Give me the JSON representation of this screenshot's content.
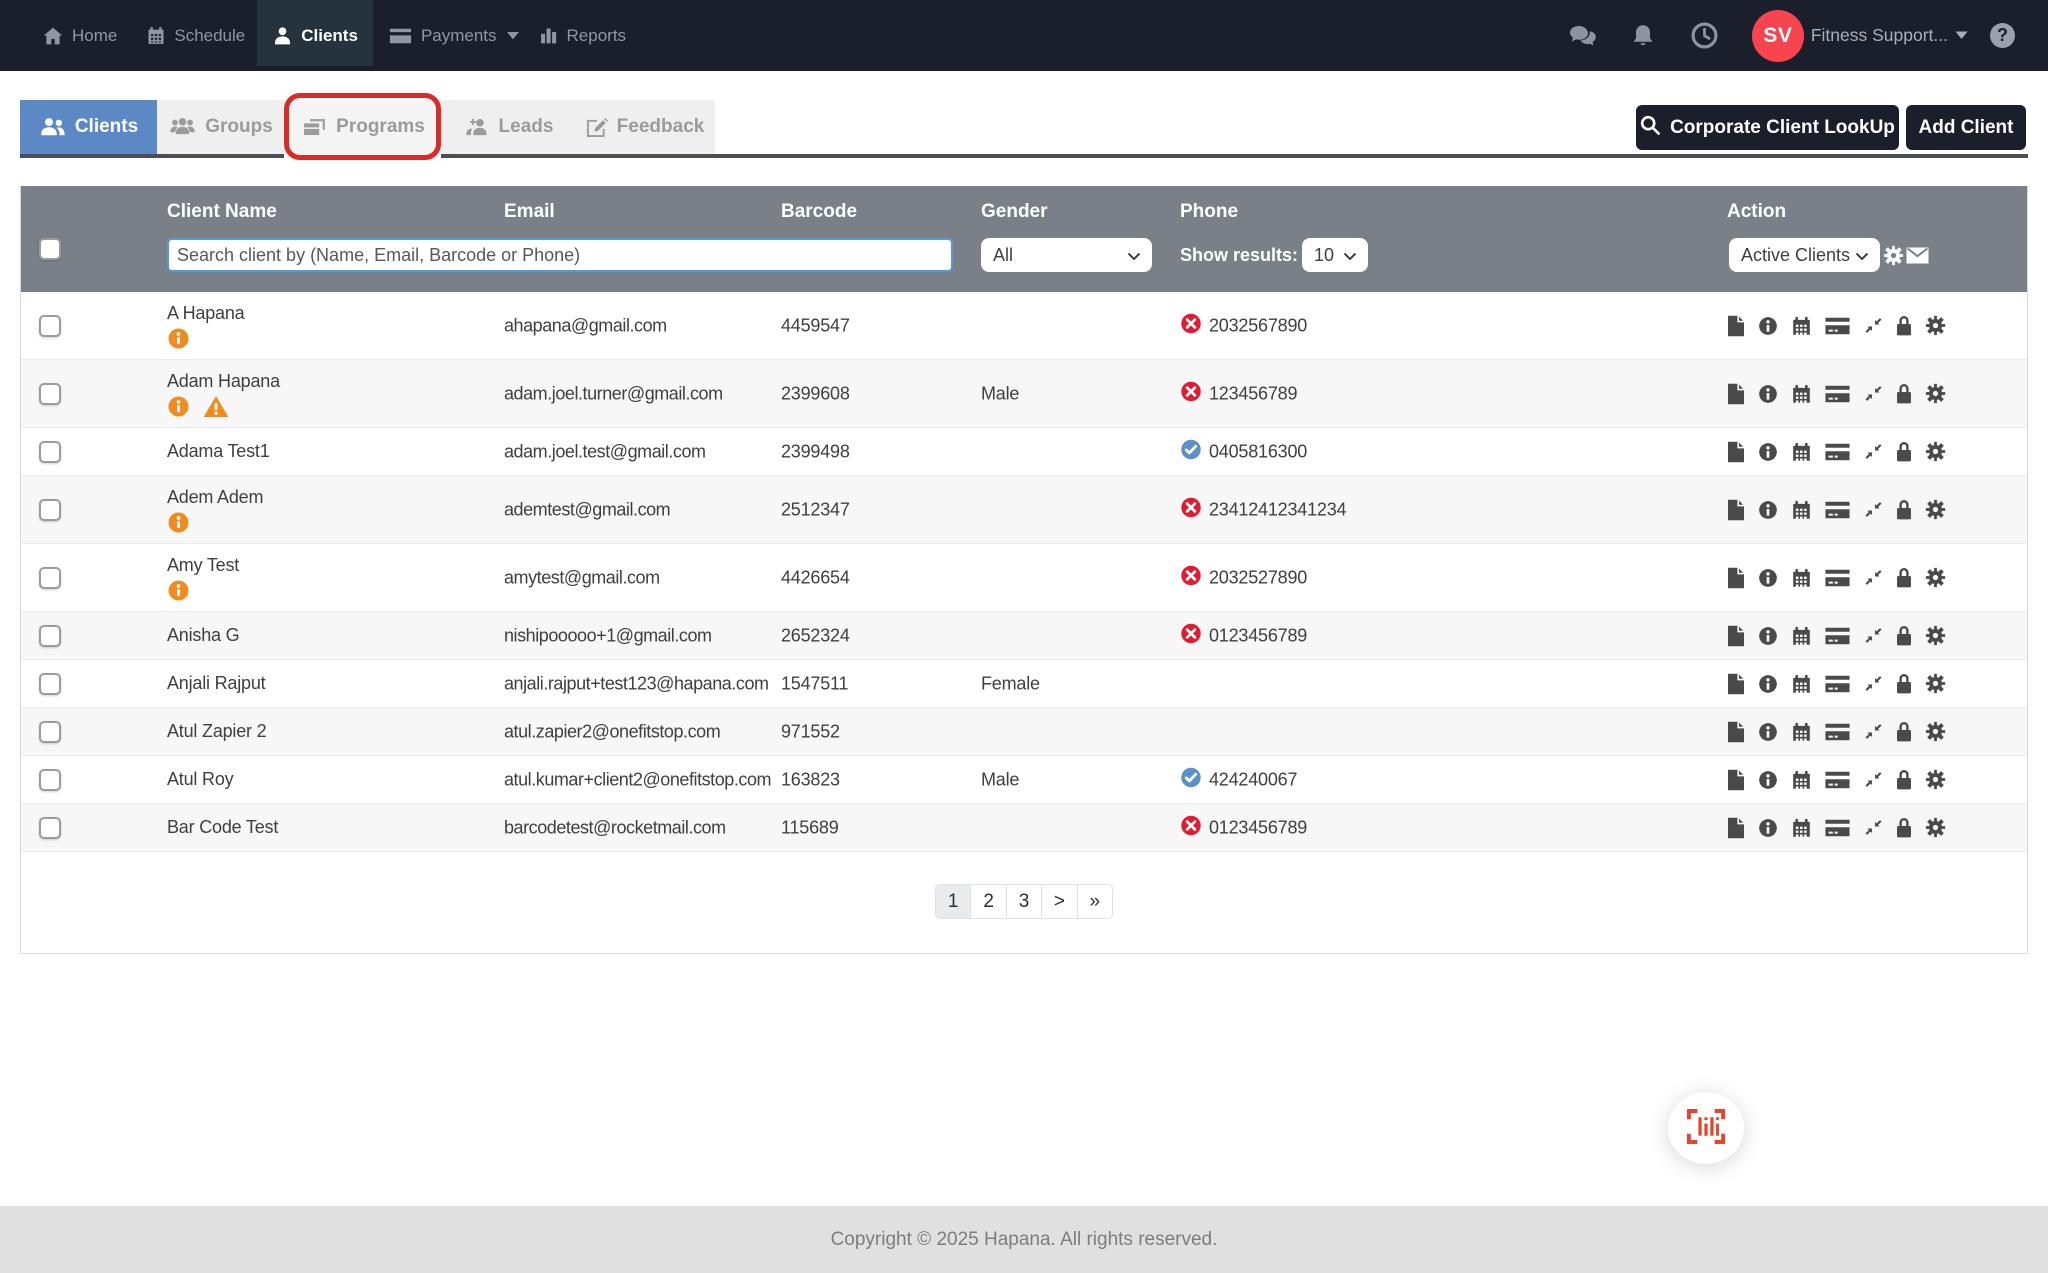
{
  "navbar": {
    "items": [
      {
        "label": "Home",
        "icon": "home-icon",
        "active": false
      },
      {
        "label": "Schedule",
        "icon": "calendar-icon",
        "active": false
      },
      {
        "label": "Clients",
        "icon": "user-icon",
        "active": true
      },
      {
        "label": "Payments",
        "icon": "credit-card-icon",
        "active": false,
        "has_dropdown": true
      },
      {
        "label": "Reports",
        "icon": "bar-chart-icon",
        "active": false
      }
    ],
    "right": {
      "icons": [
        "chat-icon",
        "bell-icon",
        "clock-icon"
      ],
      "avatar_initials": "SV",
      "user_name": "Fitness Support...",
      "help_label": "?"
    }
  },
  "tabs": [
    {
      "label": "Clients",
      "icon": "users-icon",
      "active": true
    },
    {
      "label": "Groups",
      "icon": "group-icon",
      "active": false
    },
    {
      "label": "Programs",
      "icon": "programs-icon",
      "active": false,
      "annotated": true
    },
    {
      "label": "Leads",
      "icon": "leads-icon",
      "active": false
    },
    {
      "label": "Feedback",
      "icon": "feedback-icon",
      "active": false
    }
  ],
  "annotation": {
    "type": "highlight-box",
    "target_tab": "Programs",
    "color": "#d92b27"
  },
  "actions_bar": {
    "corporate_button": "Corporate Client LookUp",
    "add_button": "Add Client"
  },
  "table": {
    "columns": {
      "name": "Client Name",
      "email": "Email",
      "barcode": "Barcode",
      "gender": "Gender",
      "phone": "Phone",
      "action": "Action"
    },
    "filters": {
      "search_placeholder": "Search client by (Name, Email, Barcode or Phone)",
      "gender_selected": "All",
      "show_results_label": "Show results:",
      "show_results_selected": "10",
      "status_selected": "Active Clients",
      "tool_icons": [
        "gear-icon",
        "envelope-icon"
      ]
    },
    "action_icons": [
      "document-icon",
      "info-icon",
      "calendar-icon",
      "payment-card-icon",
      "compress-icon",
      "lock-icon",
      "gear-icon"
    ],
    "rows": [
      {
        "name": "A Hapana",
        "info": true,
        "warning": false,
        "email": "ahapana@gmail.com",
        "barcode": "4459547",
        "gender": "",
        "phone_status": "invalid",
        "phone": "2032567890"
      },
      {
        "name": "Adam Hapana",
        "info": true,
        "warning": true,
        "email": "adam.joel.turner@gmail.com",
        "barcode": "2399608",
        "gender": "Male",
        "phone_status": "invalid",
        "phone": "123456789"
      },
      {
        "name": "Adama Test1",
        "info": false,
        "warning": false,
        "email": "adam.joel.test@gmail.com",
        "barcode": "2399498",
        "gender": "",
        "phone_status": "valid",
        "phone": "0405816300"
      },
      {
        "name": "Adem Adem",
        "info": true,
        "warning": false,
        "email": "ademtest@gmail.com",
        "barcode": "2512347",
        "gender": "",
        "phone_status": "invalid",
        "phone": "23412412341234"
      },
      {
        "name": "Amy Test",
        "info": true,
        "warning": false,
        "email": "amytest@gmail.com",
        "barcode": "4426654",
        "gender": "",
        "phone_status": "invalid",
        "phone": "2032527890"
      },
      {
        "name": "Anisha G",
        "info": false,
        "warning": false,
        "email": "nishipooooo+1@gmail.com",
        "barcode": "2652324",
        "gender": "",
        "phone_status": "invalid",
        "phone": "0123456789"
      },
      {
        "name": "Anjali Rajput",
        "info": false,
        "warning": false,
        "email": "anjali.rajput+test123@hapana.com",
        "barcode": "1547511",
        "gender": "Female",
        "phone_status": "none",
        "phone": ""
      },
      {
        "name": "Atul Zapier 2",
        "info": false,
        "warning": false,
        "email": "atul.zapier2@onefitstop.com",
        "barcode": "971552",
        "gender": "",
        "phone_status": "none",
        "phone": ""
      },
      {
        "name": "Atul Roy",
        "info": false,
        "warning": false,
        "email": "atul.kumar+client2@onefitstop.com",
        "barcode": "163823",
        "gender": "Male",
        "phone_status": "valid",
        "phone": "424240067"
      },
      {
        "name": "Bar Code Test",
        "info": false,
        "warning": false,
        "email": "barcodetest@rocketmail.com",
        "barcode": "115689",
        "gender": "",
        "phone_status": "invalid",
        "phone": "0123456789"
      }
    ]
  },
  "pagination": {
    "items": [
      "1",
      "2",
      "3",
      ">",
      "»"
    ],
    "active": "1"
  },
  "fab": {
    "icon": "barcode-scan-icon"
  },
  "footer": {
    "copyright": "Copyright © 2025 Hapana. All rights reserved."
  },
  "colors": {
    "navbar_bg": "#1b1e2b",
    "nav_active_bg": "#24333d",
    "tab_active_blue": "#5c88c6",
    "table_header_gray": "#798087",
    "info_orange": "#ef8b1f",
    "phone_invalid_red": "#e01b32",
    "phone_valid_blue": "#5c90c8",
    "avatar_red": "#f8444f",
    "annotation_red": "#d92b27",
    "barcode_fab_red": "#e2462e",
    "button_dark": "#1b1e2b",
    "footer_bg": "#e0e0e0"
  }
}
